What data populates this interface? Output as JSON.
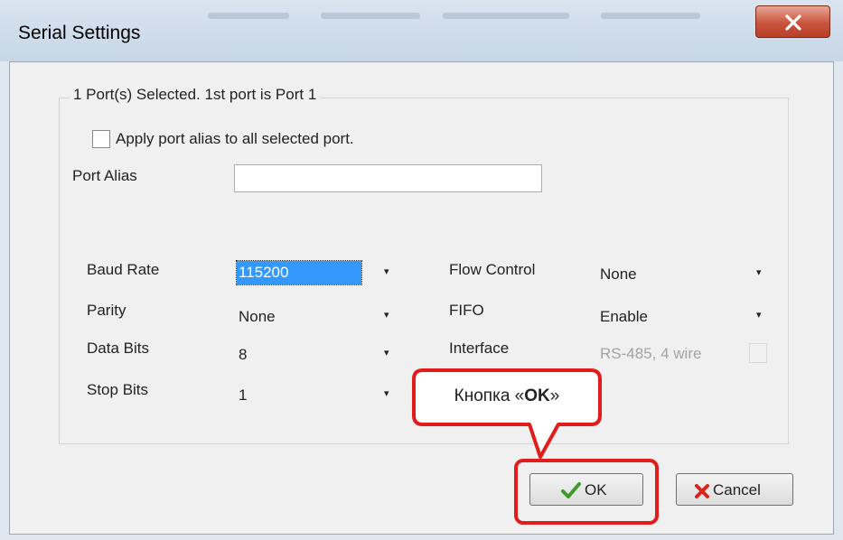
{
  "window": {
    "title": "Serial Settings",
    "close_glyph": "X"
  },
  "group": {
    "title": "1 Port(s) Selected. 1st port is Port 1"
  },
  "apply_alias": {
    "label": "Apply port alias to all selected port.",
    "checked": false
  },
  "port_alias": {
    "label": "Port Alias",
    "value": ""
  },
  "settings": {
    "baud_rate": {
      "label": "Baud Rate",
      "value": "115200"
    },
    "parity": {
      "label": "Parity",
      "value": "None"
    },
    "data_bits": {
      "label": "Data Bits",
      "value": "8"
    },
    "stop_bits": {
      "label": "Stop Bits",
      "value": "1"
    },
    "flow_control": {
      "label": "Flow Control",
      "value": "None"
    },
    "fifo": {
      "label": "FIFO",
      "value": "Enable"
    },
    "interface": {
      "label": "Interface",
      "value": "RS-485, 4 wire",
      "disabled": true
    }
  },
  "dropdown_glyph": "▾",
  "buttons": {
    "ok": "OK",
    "cancel": "Cancel"
  },
  "annotation": {
    "prefix": "Кнопка «",
    "emphasis": "OK",
    "suffix": "»",
    "color": "#e21b1b"
  },
  "icons": {
    "ok": "checkmark-icon",
    "cancel": "red-x-icon",
    "close": "close-icon"
  }
}
